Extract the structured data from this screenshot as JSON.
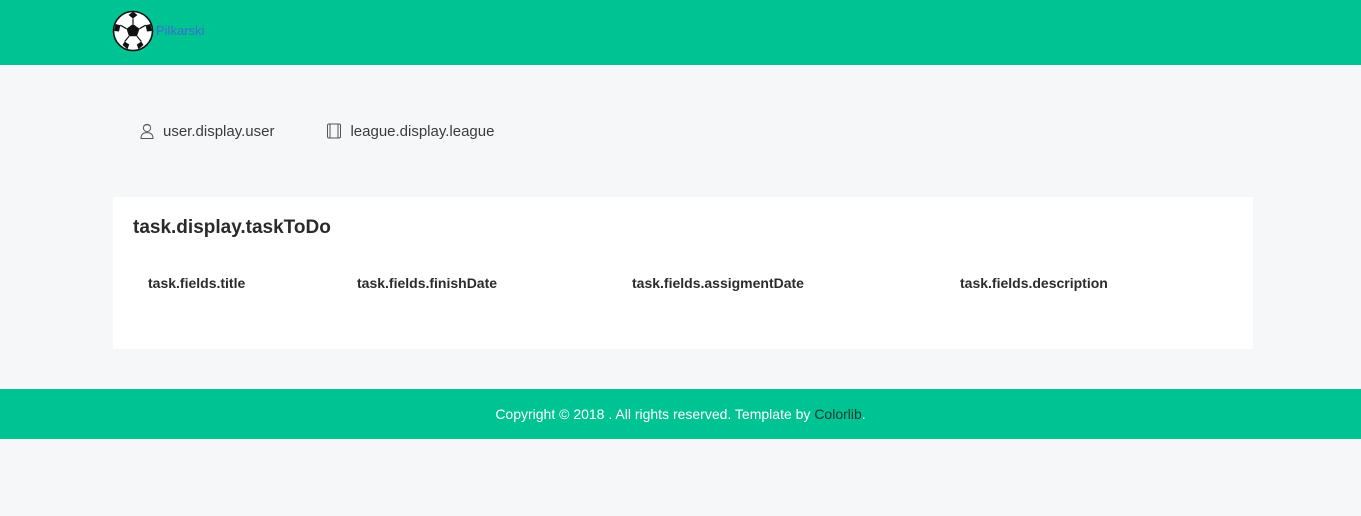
{
  "header": {
    "brand_name": "Pilkarski",
    "logo_icon": "soccer-ball-icon",
    "background_color": "#00c393"
  },
  "nav": {
    "items": [
      {
        "label": "user.display.user",
        "icon": "user-icon"
      },
      {
        "label": "league.display.league",
        "icon": "book-icon"
      }
    ]
  },
  "tasks": {
    "title": "task.display.taskToDo",
    "columns": [
      "task.fields.title",
      "task.fields.finishDate",
      "task.fields.assigmentDate",
      "task.fields.description"
    ],
    "rows": []
  },
  "footer": {
    "text_before": "Copyright © 2018 . All rights reserved. Template by ",
    "link_text": "Colorlib",
    "text_after": ".",
    "background_color": "#00c393"
  }
}
